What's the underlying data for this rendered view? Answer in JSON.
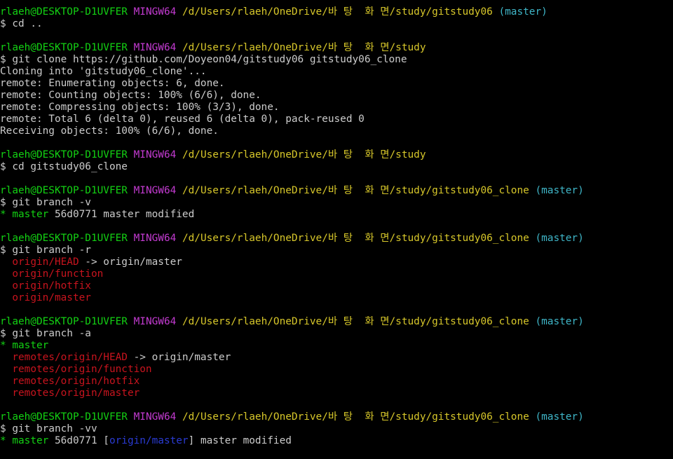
{
  "colors": {
    "background": "#000000",
    "text": "#cccccc",
    "user_host": "#13d113",
    "msystem": "#c33bd1",
    "path": "#d7c72a",
    "branch": "#3fb6c8",
    "remote_branch": "#c8141e",
    "upstream": "#2a3bd4"
  },
  "lines": [
    {
      "kind": "prompt",
      "user": "rlaeh@DESKTOP-D1UVFER",
      "msys": "MINGW64",
      "path": "/d/Users/rlaeh/OneDrive/바 탕  화 면/study/gitstudy06",
      "branch": "(master)"
    },
    {
      "kind": "cmd",
      "text": "$ cd .."
    },
    {
      "kind": "blank"
    },
    {
      "kind": "prompt",
      "user": "rlaeh@DESKTOP-D1UVFER",
      "msys": "MINGW64",
      "path": "/d/Users/rlaeh/OneDrive/바 탕  화 면/study",
      "branch": ""
    },
    {
      "kind": "cmd",
      "text": "$ git clone https://github.com/Doyeon04/gitstudy06 gitstudy06_clone"
    },
    {
      "kind": "out",
      "text": "Cloning into 'gitstudy06_clone'..."
    },
    {
      "kind": "out",
      "text": "remote: Enumerating objects: 6, done."
    },
    {
      "kind": "out",
      "text": "remote: Counting objects: 100% (6/6), done."
    },
    {
      "kind": "out",
      "text": "remote: Compressing objects: 100% (3/3), done."
    },
    {
      "kind": "out",
      "text": "remote: Total 6 (delta 0), reused 6 (delta 0), pack-reused 0"
    },
    {
      "kind": "out",
      "text": "Receiving objects: 100% (6/6), done."
    },
    {
      "kind": "blank"
    },
    {
      "kind": "prompt",
      "user": "rlaeh@DESKTOP-D1UVFER",
      "msys": "MINGW64",
      "path": "/d/Users/rlaeh/OneDrive/바 탕  화 면/study",
      "branch": ""
    },
    {
      "kind": "cmd",
      "text": "$ cd gitstudy06_clone"
    },
    {
      "kind": "blank"
    },
    {
      "kind": "prompt",
      "user": "rlaeh@DESKTOP-D1UVFER",
      "msys": "MINGW64",
      "path": "/d/Users/rlaeh/OneDrive/바 탕  화 면/study/gitstudy06_clone",
      "branch": "(master)"
    },
    {
      "kind": "cmd",
      "text": "$ git branch -v"
    },
    {
      "kind": "current_v",
      "star": "* ",
      "name": "master",
      "rest": " 56d0771 master modified"
    },
    {
      "kind": "blank"
    },
    {
      "kind": "prompt",
      "user": "rlaeh@DESKTOP-D1UVFER",
      "msys": "MINGW64",
      "path": "/d/Users/rlaeh/OneDrive/바 탕  화 면/study/gitstudy06_clone",
      "branch": "(master)"
    },
    {
      "kind": "cmd",
      "text": "$ git branch -r"
    },
    {
      "kind": "remote_head",
      "prefix": "  ",
      "name": "origin/HEAD",
      "rest": " -> origin/master"
    },
    {
      "kind": "remote",
      "prefix": "  ",
      "name": "origin/function"
    },
    {
      "kind": "remote",
      "prefix": "  ",
      "name": "origin/hotfix"
    },
    {
      "kind": "remote",
      "prefix": "  ",
      "name": "origin/master"
    },
    {
      "kind": "blank"
    },
    {
      "kind": "prompt",
      "user": "rlaeh@DESKTOP-D1UVFER",
      "msys": "MINGW64",
      "path": "/d/Users/rlaeh/OneDrive/바 탕  화 면/study/gitstudy06_clone",
      "branch": "(master)"
    },
    {
      "kind": "cmd",
      "text": "$ git branch -a"
    },
    {
      "kind": "current",
      "star": "* ",
      "name": "master"
    },
    {
      "kind": "remote_head",
      "prefix": "  ",
      "name": "remotes/origin/HEAD",
      "rest": " -> origin/master"
    },
    {
      "kind": "remote",
      "prefix": "  ",
      "name": "remotes/origin/function"
    },
    {
      "kind": "remote",
      "prefix": "  ",
      "name": "remotes/origin/hotfix"
    },
    {
      "kind": "remote",
      "prefix": "  ",
      "name": "remotes/origin/master"
    },
    {
      "kind": "blank"
    },
    {
      "kind": "prompt",
      "user": "rlaeh@DESKTOP-D1UVFER",
      "msys": "MINGW64",
      "path": "/d/Users/rlaeh/OneDrive/바 탕  화 면/study/gitstudy06_clone",
      "branch": "(master)"
    },
    {
      "kind": "cmd",
      "text": "$ git branch -vv"
    },
    {
      "kind": "current_vv",
      "star": "* ",
      "name": "master",
      "hash": " 56d0771 ",
      "open": "[",
      "upstream": "origin/master",
      "close": "]",
      "rest": " master modified"
    }
  ]
}
